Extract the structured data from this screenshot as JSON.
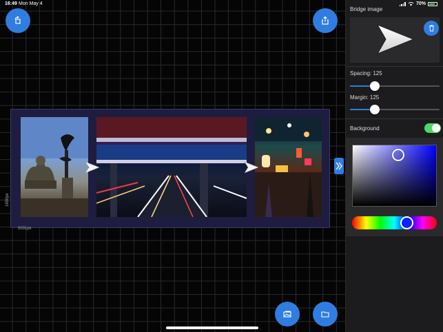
{
  "status_bar": {
    "time": "16:49",
    "date": "Mon May 4",
    "battery": "70%",
    "wifi_icon": "wifi-icon",
    "signal_icon": "cellular-signal-icon"
  },
  "canvas": {
    "top_left_button_icon": "rotate-icon",
    "top_right_button_icon": "share-icon",
    "bottom_buttons": [
      {
        "icon": "add-photo-icon"
      },
      {
        "icon": "folder-icon"
      }
    ],
    "composition": {
      "width_label": "5031px",
      "height_label": "1650px",
      "photos": [
        {
          "name": "buddha-statue-photo"
        },
        {
          "name": "highway-tunnel-light-trails-photo"
        },
        {
          "name": "night-market-alley-photo"
        }
      ],
      "bridge_icon": "white-arrow-bridge-icon",
      "expand_icon": "double-chevron-right-icon"
    }
  },
  "panel": {
    "title": "Bridge image",
    "delete_icon": "trash-icon",
    "spacing": {
      "label": "Spacing: 125",
      "value_fraction": 0.28
    },
    "margin": {
      "label": "Margin: 125",
      "value_fraction": 0.28
    },
    "background": {
      "label": "Background",
      "enabled": true
    },
    "color_picker": {
      "selected_hue": "#0000ff",
      "accent": "#2f7de0",
      "toggle_color": "#4cd964"
    }
  }
}
